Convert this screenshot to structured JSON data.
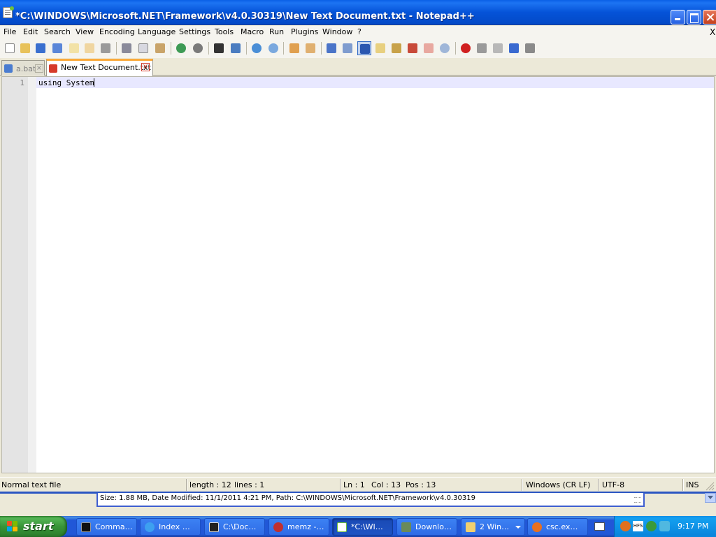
{
  "window": {
    "title": "*C:\\WINDOWS\\Microsoft.NET\\Framework\\v4.0.30319\\New Text Document.txt - Notepad++"
  },
  "menu": {
    "items": [
      "File",
      "Edit",
      "Search",
      "View",
      "Encoding",
      "Language",
      "Settings",
      "Tools",
      "Macro",
      "Run",
      "Plugins",
      "Window",
      "?"
    ],
    "close_doc": "X"
  },
  "toolbar": {
    "icons": [
      "new-file-icon",
      "open-file-icon",
      "save-icon",
      "save-all-icon",
      "close-icon",
      "close-all-icon",
      "print-icon",
      "cut-icon",
      "copy-icon",
      "paste-icon",
      "undo-icon",
      "redo-icon",
      "find-icon",
      "replace-icon",
      "zoom-in-icon",
      "zoom-out-icon",
      "sync-vertical-icon",
      "sync-horizontal-icon",
      "word-wrap-icon",
      "show-all-chars-icon",
      "indent-guide-icon",
      "udl-icon",
      "doc-map-icon",
      "function-list-icon",
      "folder-workspace-icon",
      "monitoring-icon",
      "record-macro-icon",
      "stop-record-icon",
      "play-macro-icon",
      "run-macro-multiple-icon",
      "save-macro-icon"
    ]
  },
  "tabs": [
    {
      "label": "a.bat",
      "active": false
    },
    {
      "label": "New Text Document.txt",
      "active": true
    }
  ],
  "editor": {
    "line_number": "1",
    "content": "using System"
  },
  "status": {
    "file_type": "Normal text file",
    "length": "length : 12",
    "lines": "lines : 1",
    "ln": "Ln : 1",
    "col": "Col : 13",
    "pos": "Pos : 13",
    "eol": "Windows (CR LF)",
    "encoding": "UTF-8",
    "mode": "INS"
  },
  "tooltip": {
    "text": "Size: 1.88 MB, Date Modified: 11/1/2011 4:21 PM, Path: C:\\WINDOWS\\Microsoft.NET\\Framework\\v4.0.30319"
  },
  "taskbar": {
    "start_label": "start",
    "tasks": [
      {
        "label": "Comma…",
        "icon": "command-prompt-icon"
      },
      {
        "label": "Index …",
        "icon": "internet-explorer-icon"
      },
      {
        "label": "C:\\Doc…",
        "icon": "7zip-icon"
      },
      {
        "label": "memz -…",
        "icon": "memz-icon"
      },
      {
        "label": "*C:\\WI…",
        "icon": "notepadpp-icon"
      },
      {
        "label": "Downlo…",
        "icon": "download-icon"
      },
      {
        "label": "2 Win…",
        "icon": "folder-icon"
      },
      {
        "label": "csc.ex…",
        "icon": "search-icon"
      }
    ],
    "tray_text": "HFS",
    "clock": "9:17 PM"
  }
}
